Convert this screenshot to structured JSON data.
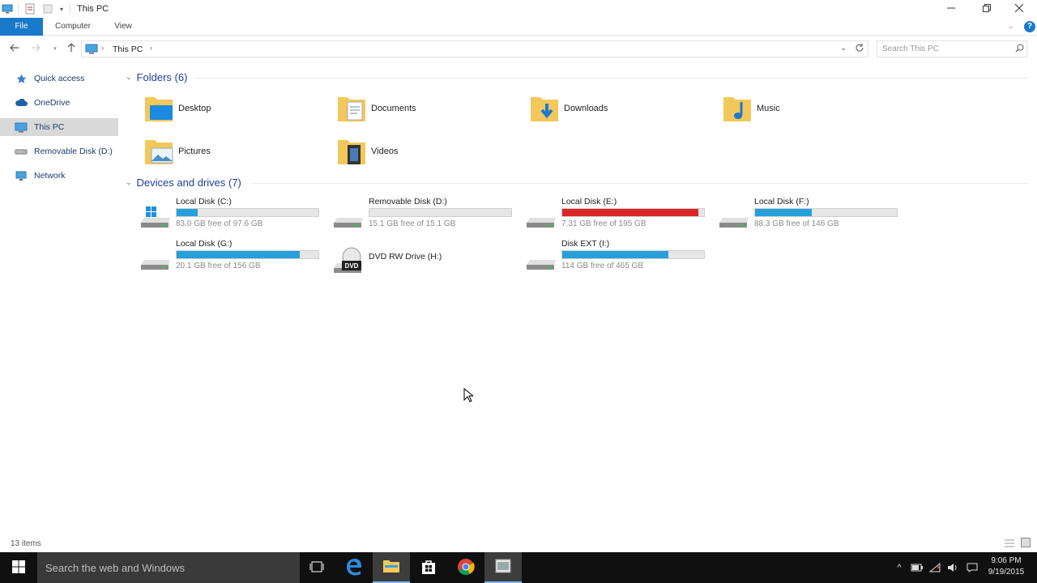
{
  "window": {
    "title": "This PC",
    "controls": {
      "minimize": "minimize-icon",
      "maximize": "maximize-icon",
      "close": "close-icon"
    }
  },
  "ribbon": {
    "tabs": [
      "File",
      "Computer",
      "View"
    ]
  },
  "address": {
    "crumbs": [
      "This PC"
    ],
    "search_placeholder": "Search This PC"
  },
  "sidebar": {
    "items": [
      {
        "label": "Quick access",
        "icon": "quick-access-star-icon"
      },
      {
        "label": "OneDrive",
        "icon": "onedrive-cloud-icon"
      },
      {
        "label": "This PC",
        "icon": "this-pc-icon",
        "selected": true
      },
      {
        "label": "Removable Disk (D:)",
        "icon": "removable-disk-icon"
      },
      {
        "label": "Network",
        "icon": "network-icon"
      }
    ]
  },
  "folders": {
    "header": "Folders (6)",
    "items": [
      {
        "label": "Desktop",
        "icon": "desktop-folder-icon"
      },
      {
        "label": "Documents",
        "icon": "documents-folder-icon"
      },
      {
        "label": "Downloads",
        "icon": "downloads-folder-icon"
      },
      {
        "label": "Music",
        "icon": "music-folder-icon"
      },
      {
        "label": "Pictures",
        "icon": "pictures-folder-icon"
      },
      {
        "label": "Videos",
        "icon": "videos-folder-icon"
      }
    ]
  },
  "drives": {
    "header": "Devices and drives (7)",
    "items": [
      {
        "name": "Local Disk (C:)",
        "free": "83.0 GB free of 97.6 GB",
        "used_fraction": 0.15,
        "icon": "windows-drive-icon"
      },
      {
        "name": "Removable Disk (D:)",
        "free": "15.1 GB free of 15.1 GB",
        "used_fraction": 0.0,
        "icon": "removable-drive-icon"
      },
      {
        "name": "Local Disk (E:)",
        "free": "7.31 GB free of 195 GB",
        "used_fraction": 0.96,
        "icon": "hard-drive-icon",
        "critical": true
      },
      {
        "name": "Local Disk (F:)",
        "free": "88.3 GB free of 146 GB",
        "used_fraction": 0.4,
        "icon": "hard-drive-icon"
      },
      {
        "name": "Local Disk (G:)",
        "free": "20.1 GB free of 156 GB",
        "used_fraction": 0.87,
        "icon": "hard-drive-icon"
      },
      {
        "name": "DVD RW Drive (H:)",
        "icon": "dvd-drive-icon"
      },
      {
        "name": "Disk EXT (I:)",
        "free": "114 GB free of 465 GB",
        "used_fraction": 0.75,
        "icon": "hard-drive-icon"
      }
    ]
  },
  "status": {
    "items": "13 items"
  },
  "taskbar": {
    "search_placeholder": "Search the web and Windows",
    "apps": [
      "task-view-icon",
      "edge-icon",
      "file-explorer-icon",
      "store-icon",
      "chrome-icon",
      "app-icon"
    ],
    "time": "9:06 PM",
    "date": "9/19/2015"
  },
  "colors": {
    "accent": "#1979ca",
    "bar_normal": "#26a0da",
    "bar_critical": "#da2626",
    "taskbar": "#101010"
  }
}
